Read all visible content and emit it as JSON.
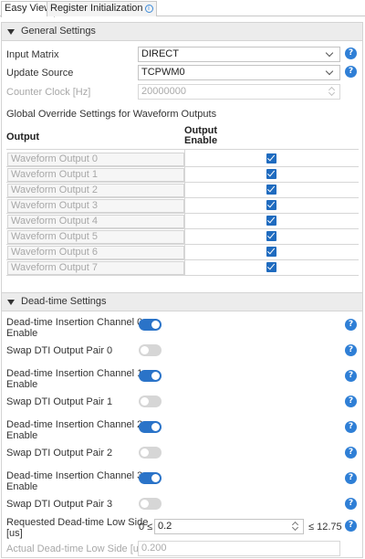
{
  "tabs": [
    {
      "label": "Easy View",
      "active": true
    },
    {
      "label": "Register Initialization",
      "active": false
    }
  ],
  "general": {
    "title": "General Settings",
    "input_matrix": {
      "label": "Input Matrix",
      "value": "DIRECT"
    },
    "update_source": {
      "label": "Update Source",
      "value": "TCPWM0"
    },
    "counter_clock": {
      "label": "Counter Clock [Hz]",
      "value": "20000000"
    },
    "override_title": "Global Override Settings for Waveform Outputs",
    "table": {
      "col_output": "Output",
      "col_enable_1": "Output",
      "col_enable_2": "Enable",
      "rows": [
        {
          "name": "Waveform Output 0",
          "enabled": true
        },
        {
          "name": "Waveform Output 1",
          "enabled": true
        },
        {
          "name": "Waveform Output 2",
          "enabled": true
        },
        {
          "name": "Waveform Output 3",
          "enabled": true
        },
        {
          "name": "Waveform Output 4",
          "enabled": true
        },
        {
          "name": "Waveform Output 5",
          "enabled": true
        },
        {
          "name": "Waveform Output 6",
          "enabled": true
        },
        {
          "name": "Waveform Output 7",
          "enabled": true
        }
      ]
    }
  },
  "deadtime": {
    "title": "Dead-time Settings",
    "items": [
      {
        "label_1": "Dead-time Insertion Channel 0",
        "label_2": "Enable",
        "on": true
      },
      {
        "label_1": "Swap DTI Output Pair 0",
        "label_2": "",
        "on": false
      },
      {
        "label_1": "Dead-time Insertion Channel 1",
        "label_2": "Enable",
        "on": true
      },
      {
        "label_1": "Swap DTI Output Pair 1",
        "label_2": "",
        "on": false
      },
      {
        "label_1": "Dead-time Insertion Channel 2",
        "label_2": "Enable",
        "on": true
      },
      {
        "label_1": "Swap DTI Output Pair 2",
        "label_2": "",
        "on": false
      },
      {
        "label_1": "Dead-time Insertion Channel 3",
        "label_2": "Enable",
        "on": true
      },
      {
        "label_1": "Swap DTI Output Pair 3",
        "label_2": "",
        "on": false
      }
    ],
    "requested": {
      "label_1": "Requested Dead-time Low Side",
      "label_2": "[us]",
      "min_text": "0 ≤",
      "value": "0.2",
      "max_text": "≤ 12.75"
    },
    "actual": {
      "label": "Actual Dead-time Low Side [us]",
      "value": "0.200"
    }
  },
  "icons": {
    "help": "?",
    "info": "i"
  },
  "colors": {
    "accent": "#2a73c8",
    "help": "#2f7fd6",
    "checkbox": "#1f6bbf"
  }
}
